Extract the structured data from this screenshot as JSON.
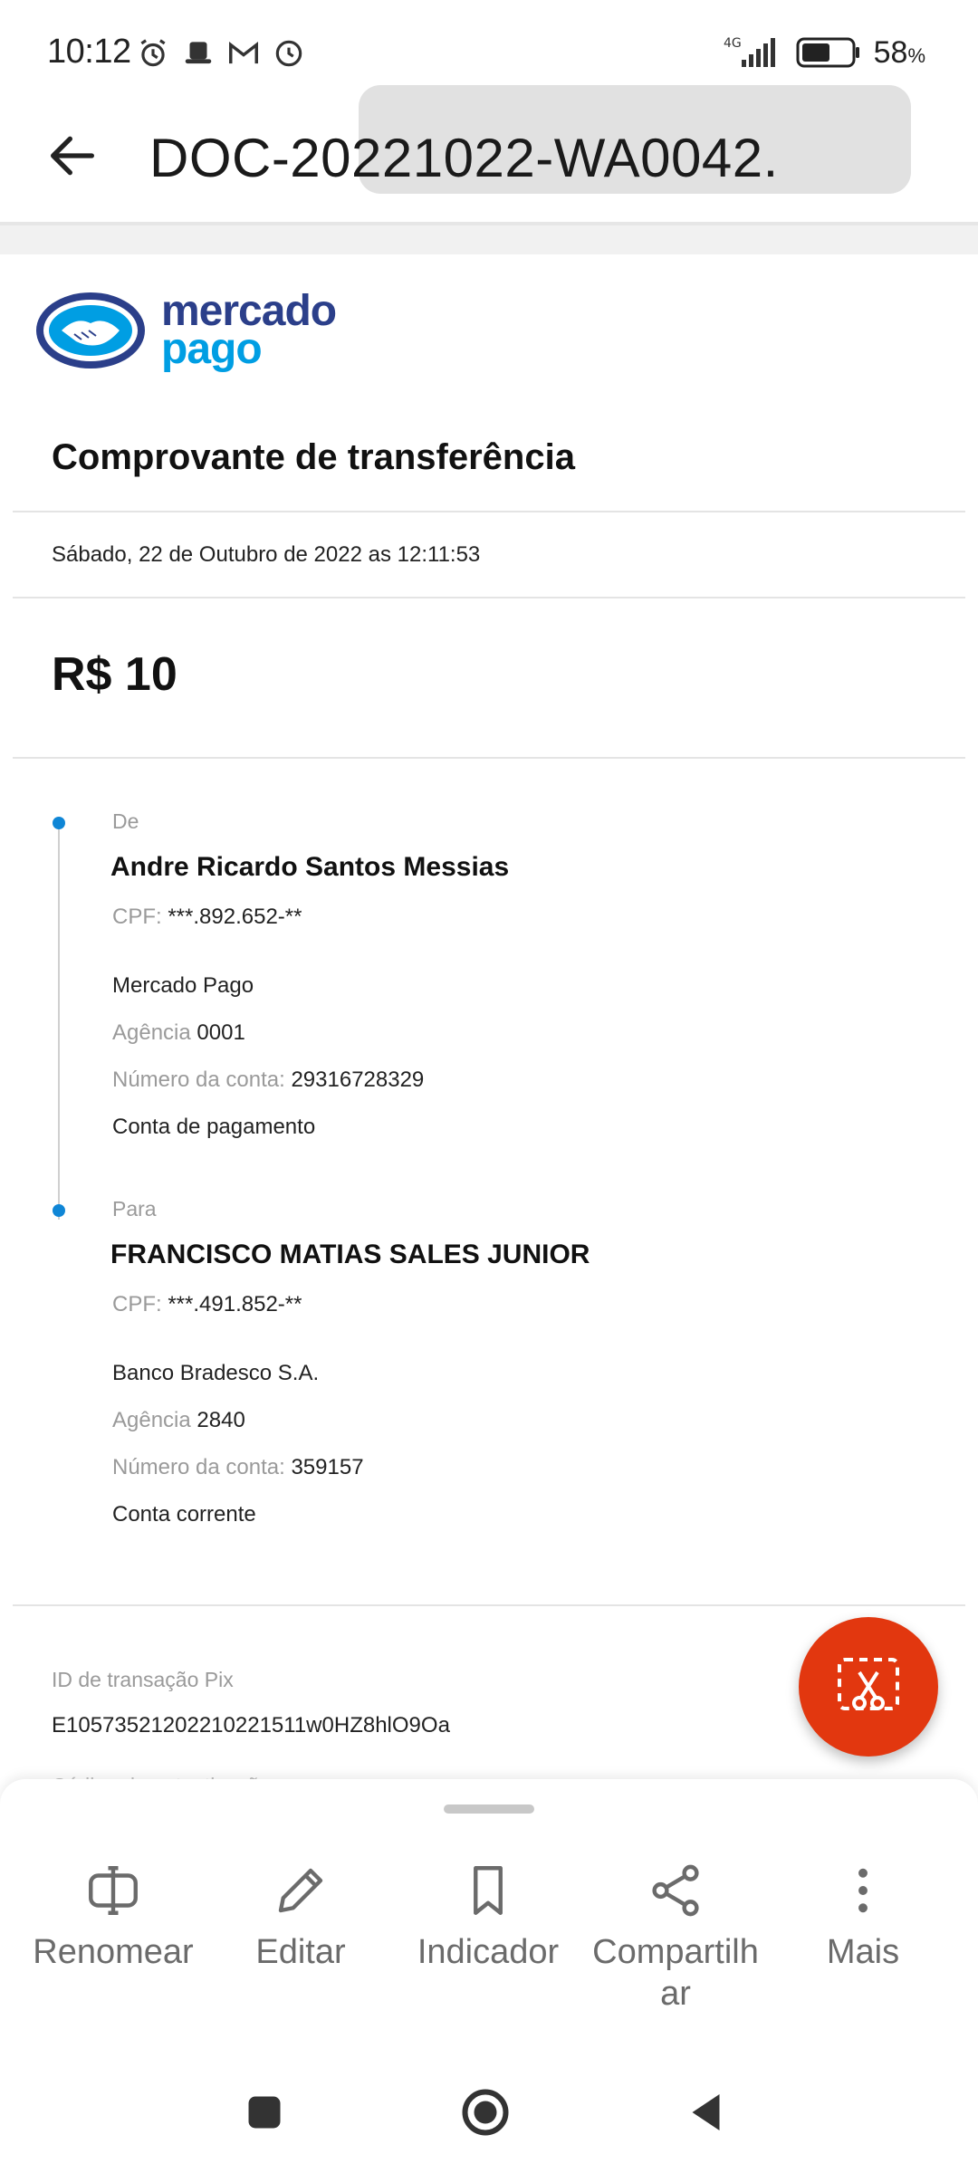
{
  "status_bar": {
    "time": "10:12",
    "network": "4G",
    "battery": "58",
    "battery_unit": "%"
  },
  "app_bar": {
    "title": "DOC-20221022-WA0042."
  },
  "document": {
    "logo": {
      "line1": "mercado",
      "line2": "pago"
    },
    "title": "Comprovante de transferência",
    "date": "Sábado, 22 de Outubro de 2022 as 12:11:53",
    "amount": "R$ 10",
    "from": {
      "label": "De",
      "name": "Andre Ricardo Santos Messias",
      "cpf_label": "CPF:",
      "cpf": "***.892.652-**",
      "bank": "Mercado Pago",
      "agency_label": "Agência",
      "agency": "0001",
      "account_label": "Número da conta:",
      "account": "29316728329",
      "account_type": "Conta de pagamento"
    },
    "to": {
      "label": "Para",
      "name": "FRANCISCO MATIAS SALES JUNIOR",
      "cpf_label": "CPF:",
      "cpf": "***.491.852-**",
      "bank": "Banco Bradesco S.A.",
      "agency_label": "Agência",
      "agency": "2840",
      "account_label": "Número da conta:",
      "account": "359157",
      "account_type": "Conta corrente"
    },
    "pix_id_label": "ID de transação Pix",
    "pix_id": "E10573521202210221511w0HZ8hlO9Oa",
    "cut_off_label": "Código de autenticação"
  },
  "bottom_sheet": {
    "actions": [
      {
        "label": "Renomear",
        "icon": "rename-icon"
      },
      {
        "label": "Editar",
        "icon": "pencil-icon"
      },
      {
        "label": "Indicador",
        "icon": "bookmark-icon"
      },
      {
        "label": "Compartilhar",
        "icon": "share-icon"
      },
      {
        "label": "Mais",
        "icon": "more-vertical-icon"
      }
    ]
  },
  "colors": {
    "fab": "#e2370f",
    "timeline_dot": "#0f86d6",
    "logo_dark": "#2b3f8a",
    "logo_light": "#009ee3"
  }
}
